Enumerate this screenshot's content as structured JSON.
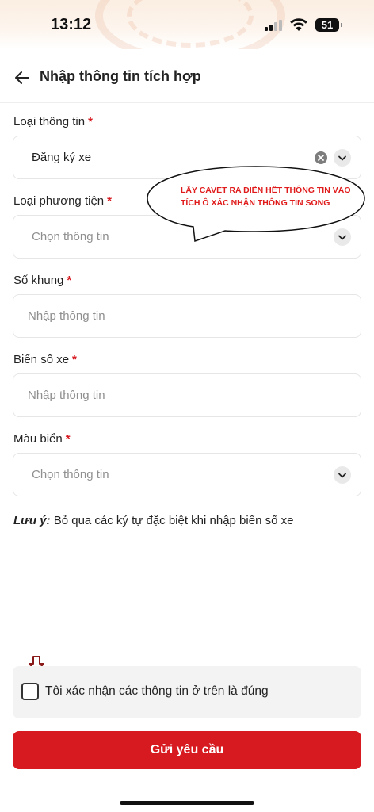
{
  "status_bar": {
    "time": "13:12",
    "battery": "51"
  },
  "header": {
    "title": "Nhập thông tin tích hợp"
  },
  "fields": {
    "info_type": {
      "label": "Loại thông tin",
      "value": "Đăng ký xe"
    },
    "vehicle_type": {
      "label": "Loại phương tiện",
      "placeholder": "Chọn thông tin"
    },
    "chassis_number": {
      "label": "Số khung",
      "placeholder": "Nhập thông tin"
    },
    "plate_number": {
      "label": "Biển số xe",
      "placeholder": "Nhập thông tin"
    },
    "plate_color": {
      "label": "Màu biển",
      "placeholder": "Chọn thông tin"
    }
  },
  "required_mark": "*",
  "note": {
    "prefix": "Lưu ý:",
    "text": " Bỏ qua các ký tự đặc biệt khi nhập biển số xe"
  },
  "annotation": {
    "line1": "LẤY CAVET RA ĐIỀN HẾT THÔNG TIN VÀO",
    "line2": "TÍCH Ô XÁC NHẬN THÔNG TIN SONG",
    "color": "#e01b1b"
  },
  "confirm": {
    "label": "Tôi xác nhận các thông tin ở trên là đúng",
    "checked": false
  },
  "submit": {
    "label": "Gửi yêu cầu"
  },
  "colors": {
    "primary": "#d71920",
    "background": "#ffffff"
  }
}
